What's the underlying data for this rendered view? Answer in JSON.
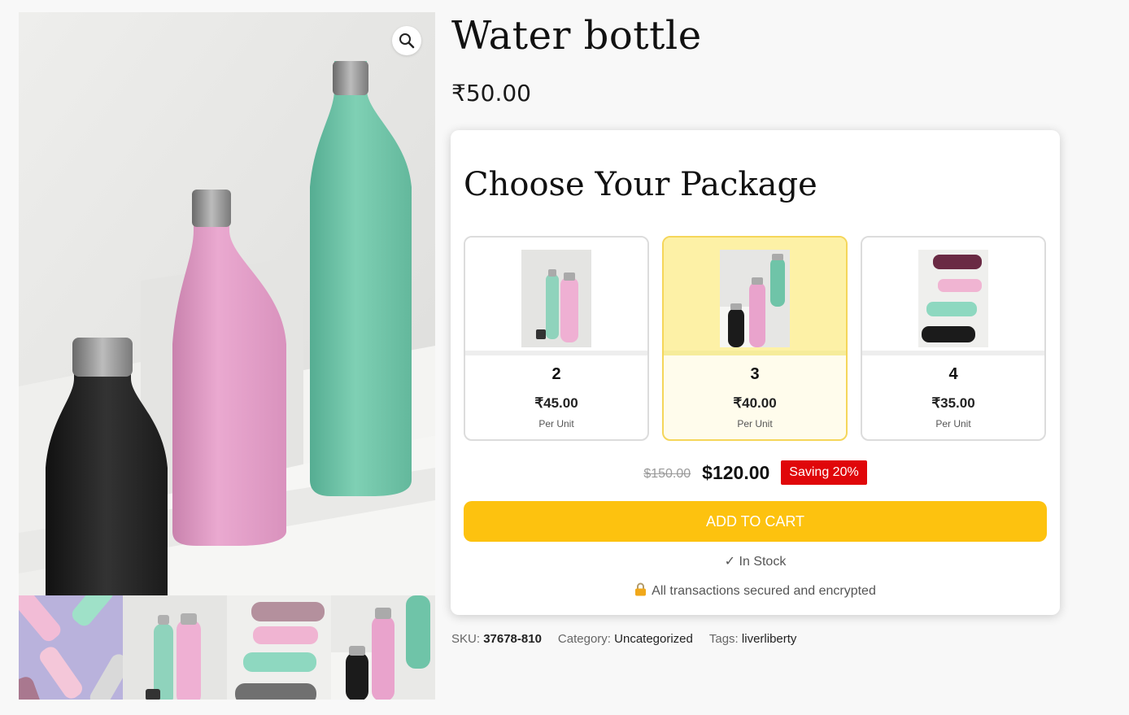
{
  "product": {
    "title": "Water bottle",
    "price": "₹50.00"
  },
  "gallery": {
    "zoom_icon": "magnifier-icon",
    "thumbnail_count": 4
  },
  "bundle": {
    "heading": "Choose Your Package",
    "options": [
      {
        "qty": "2",
        "price": "₹45.00",
        "unit": "Per Unit",
        "selected": false
      },
      {
        "qty": "3",
        "price": "₹40.00",
        "unit": "Per Unit",
        "selected": true
      },
      {
        "qty": "4",
        "price": "₹35.00",
        "unit": "Per Unit",
        "selected": false
      }
    ],
    "old_total": "$150.00",
    "new_total": "$120.00",
    "saving": "Saving 20%",
    "add_to_cart": "ADD TO CART",
    "stock": "✓ In Stock",
    "secure": "All transactions secured and encrypted"
  },
  "meta": {
    "sku_label": "SKU:",
    "sku": "37678-810",
    "category_label": "Category:",
    "category": "Uncategorized",
    "tags_label": "Tags:",
    "tags": "liverliberty"
  },
  "colors": {
    "accent": "#fdc20f",
    "badge": "#e0070a",
    "selected_card": "#fdf1a6",
    "bottle_mint": "#6fc4a8",
    "bottle_pink": "#e9a3cc",
    "bottle_black": "#222222"
  }
}
